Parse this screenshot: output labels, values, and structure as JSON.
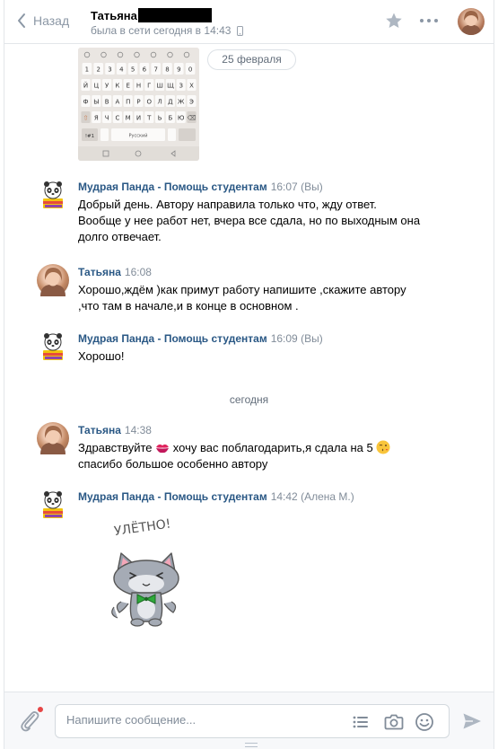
{
  "header": {
    "back_label": "Назад",
    "peer_name": "Татьяна",
    "peer_status": "была в сети сегодня в 14:43"
  },
  "keyboard_image": {
    "rows": [
      [
        "1",
        "2",
        "3",
        "4",
        "5",
        "6",
        "7",
        "8",
        "9",
        "0"
      ],
      [
        "Й",
        "Ц",
        "У",
        "К",
        "Е",
        "Н",
        "Г",
        "Ш",
        "Щ",
        "З",
        "Х"
      ],
      [
        "Ф",
        "Ы",
        "В",
        "А",
        "П",
        "Р",
        "О",
        "Л",
        "Д",
        "Ж",
        "Э"
      ],
      [
        "Я",
        "Ч",
        "С",
        "М",
        "И",
        "Т",
        "Ь",
        "Б",
        "Ю"
      ]
    ],
    "space_label": "Русский",
    "mode_label": "!#1"
  },
  "date_pill": "25 февраля",
  "day_separator": "сегодня",
  "messages": [
    {
      "author": "Мудрая Панда - Помощь студентам",
      "time": "16:07 (Вы)",
      "lines": [
        "Добрый день. Автору направила только что, жду ответ.",
        "Вообще у нее работ нет, вчера все сдала, но по выходным она",
        "долго отвечает."
      ]
    },
    {
      "author": "Татьяна",
      "time": "16:08",
      "lines": [
        "Хорошо,ждём )как примут работу напишите ,скажите автору",
        ",что там в начале,и в конце в основном ."
      ]
    },
    {
      "author": "Мудрая Панда - Помощь студентам",
      "time": "16:09 (Вы)",
      "lines": [
        "Хорошо!"
      ]
    },
    {
      "author": "Татьяна",
      "time": "14:38",
      "line1_a": "Здравствуйте",
      "line1_b": "хочу вас поблагодарить,я сдала на 5",
      "line2": "спасибо большое особенно автору"
    },
    {
      "author": "Мудрая Панда - Помощь студентам",
      "time": "14:42 (Алена М.)",
      "sticker_text": "УЛЁТНО!"
    }
  ],
  "composer": {
    "placeholder": "Напишите сообщение..."
  },
  "colors": {
    "link": "#2a5885",
    "muted": "#818c99",
    "border": "#e3e6ea",
    "notification": "#e64646"
  }
}
